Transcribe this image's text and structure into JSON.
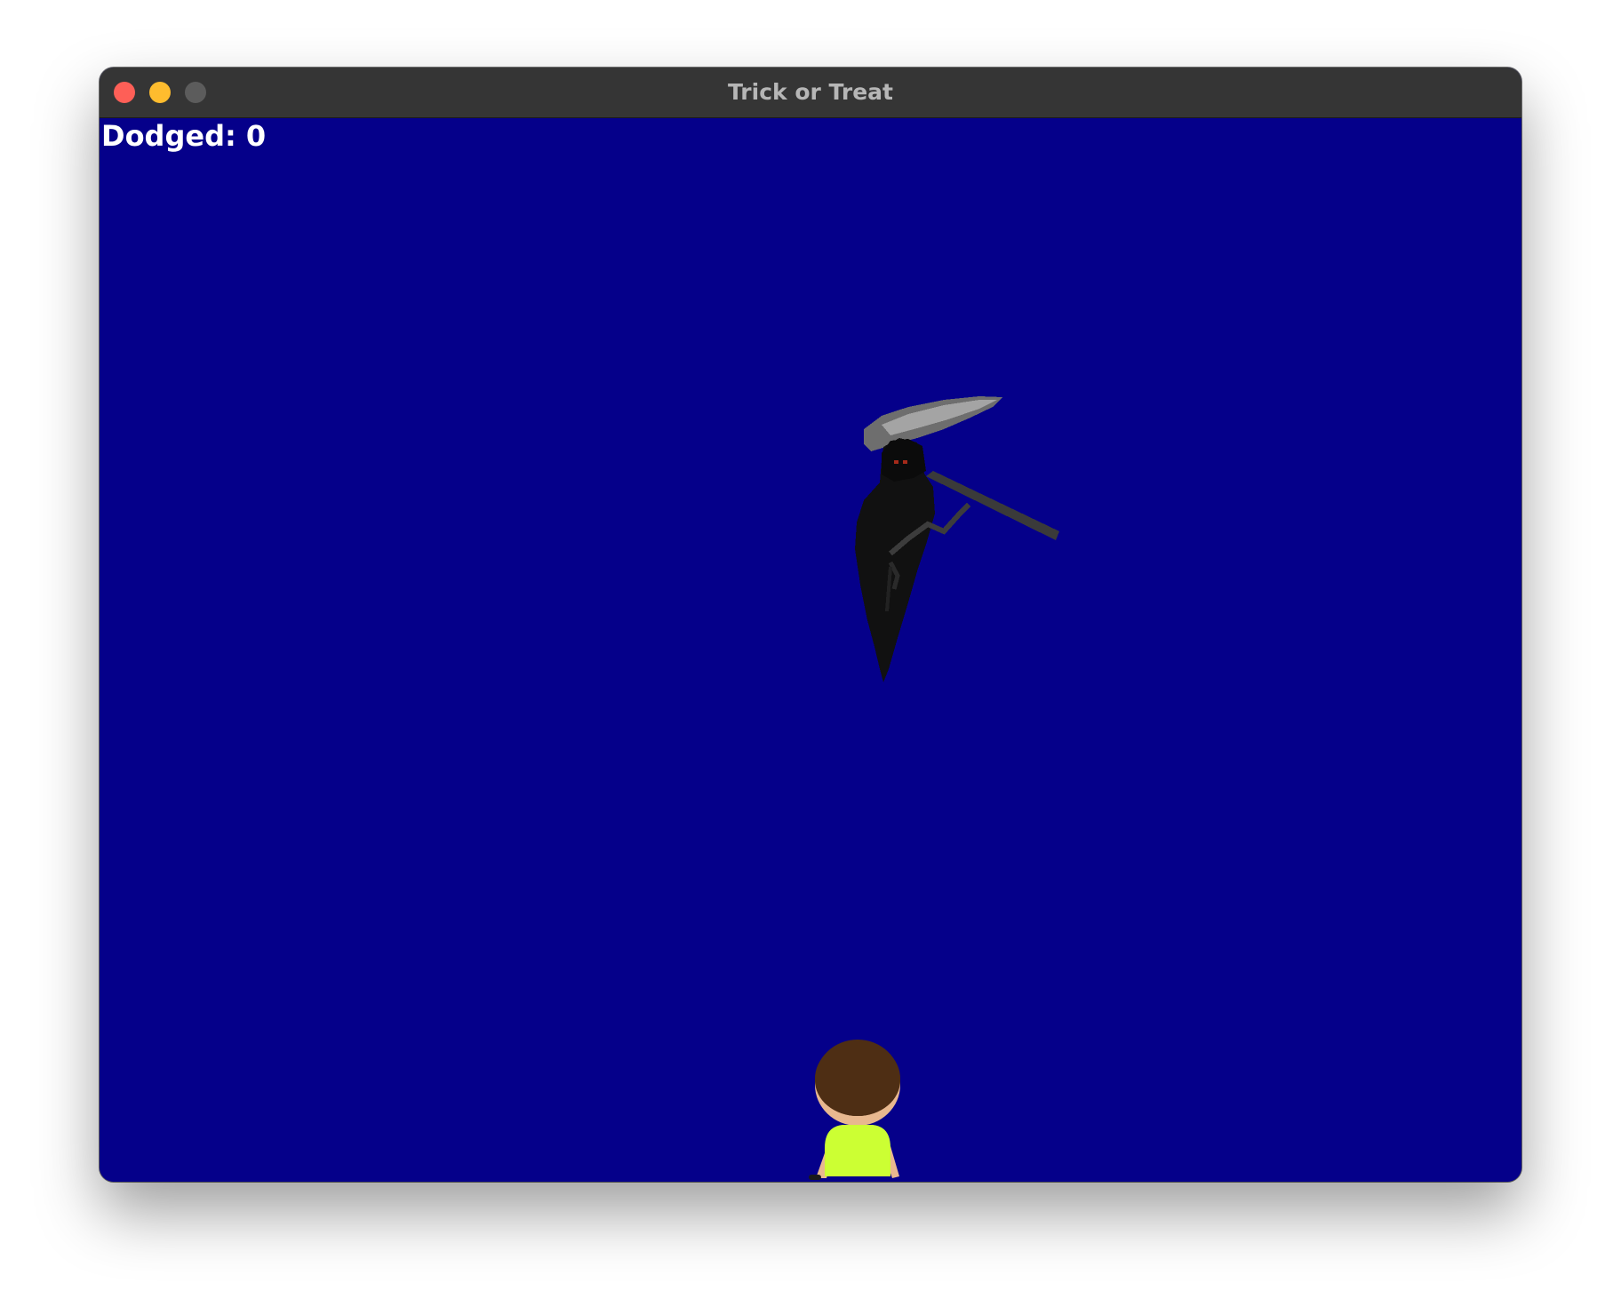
{
  "window": {
    "title": "Trick or Treat"
  },
  "hud": {
    "dodged_text": "Dodged: 0"
  },
  "sprites": {
    "enemy": "grim-reaper-sprite",
    "player": "child-player-sprite"
  },
  "colors": {
    "sky": "#05008a",
    "titlebar": "#353535",
    "close": "#fe5f57",
    "minimize": "#febc2e",
    "zoom": "#5c5c5c",
    "reaper_robe": "#111111",
    "scythe_blade": "#8a8a8a",
    "reaper_eyes": "#a52a1a",
    "kid_hair": "#4e2e14",
    "kid_skin": "#e8b88f",
    "kid_shirt": "#ccff33"
  }
}
